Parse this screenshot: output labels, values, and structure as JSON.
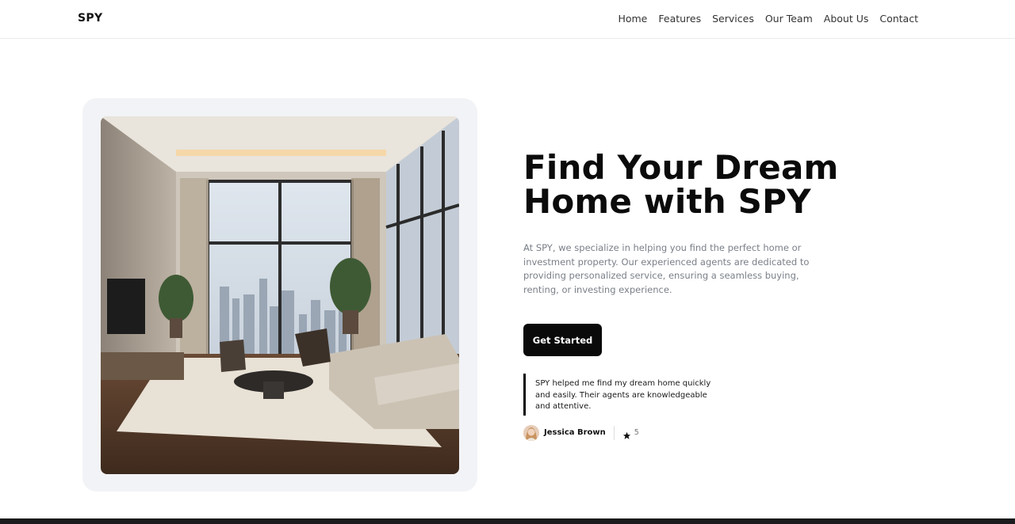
{
  "brand": {
    "logo": "SPY"
  },
  "nav": {
    "items": [
      "Home",
      "Features",
      "Services",
      "Our Team",
      "About Us",
      "Contact"
    ]
  },
  "hero": {
    "headline": "Find Your Dream Home with SPY",
    "description": "At SPY, we specialize in helping you find the perfect home or investment property. Our experienced agents are dedicated to providing personalized service, ensuring a seamless buying, renting, or investing experience.",
    "cta_label": "Get Started",
    "image_name": "living-room-photo"
  },
  "testimonial": {
    "quote": "SPY helped me find my dream home quickly and easily. Their agents are knowledgeable and attentive.",
    "author": "Jessica Brown",
    "rating": "5",
    "rating_icon": "star-icon"
  },
  "colors": {
    "accent": "#0a0a0a",
    "card_bg": "#f2f3f6",
    "muted_text": "#7a7f88"
  }
}
